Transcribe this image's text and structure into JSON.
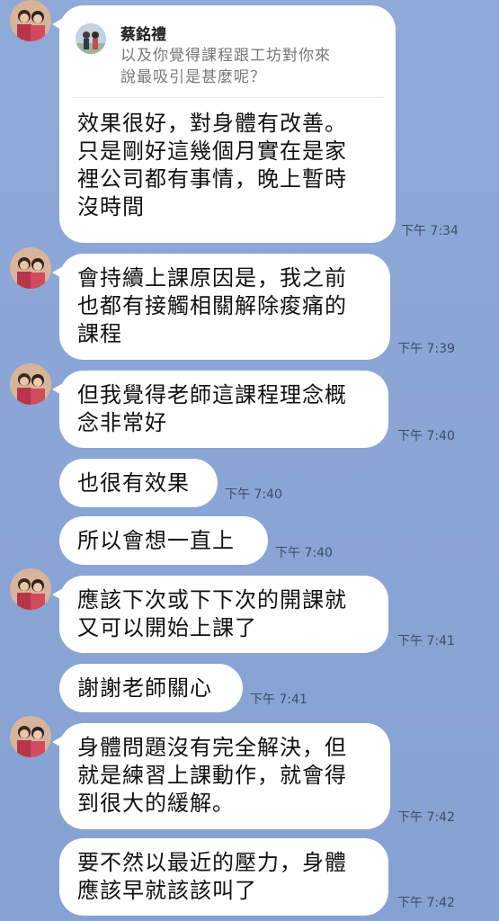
{
  "reply_preview": {
    "sender": "蔡銘禮",
    "text": "以及你覺得課程跟工坊對你來\n說最吸引是甚麼呢？"
  },
  "messages": [
    {
      "text": "效果很好，對身體有改善。\n只是剛好這幾個月實在是家\n裡公司都有事情，晚上暫時\n沒時間",
      "time": "下午 7:34"
    },
    {
      "text": "會持續上課原因是，我之前\n也都有接觸相關解除痠痛的\n課程",
      "time": "下午 7:39"
    },
    {
      "text": "但我覺得老師這課程理念概\n念非常好",
      "time": "下午 7:40"
    },
    {
      "text": "也很有效果",
      "time": "下午 7:40"
    },
    {
      "text": "所以會想一直上",
      "time": "下午 7:40"
    },
    {
      "text": "應該下次或下下次的開課就\n又可以開始上課了",
      "time": "下午 7:41"
    },
    {
      "text": "謝謝老師關心",
      "time": "下午 7:41"
    },
    {
      "text": "身體問題沒有完全解決，但\n就是練習上課動作，就會得\n到很大的緩解。",
      "time": "下午 7:42"
    },
    {
      "text": "要不然以最近的壓力，身體\n應該早就該該叫了",
      "time": "下午 7:42"
    }
  ],
  "colors": {
    "background": "#8aa5d6",
    "bubble": "#ffffff",
    "timestamp": "#3c4c66"
  }
}
